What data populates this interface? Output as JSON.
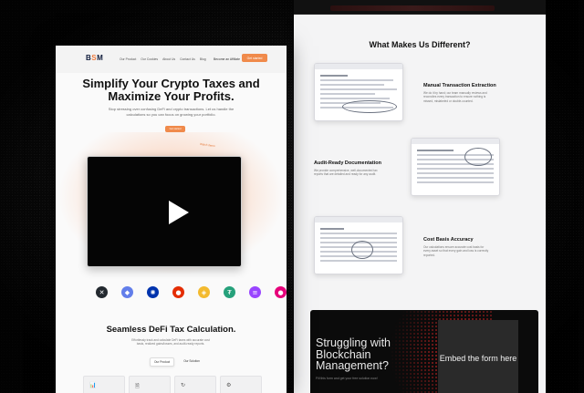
{
  "left_page": {
    "nav": {
      "logo": {
        "b": "B",
        "s": "S",
        "m": "M"
      },
      "links": [
        "Our Product",
        "Our Cookies",
        "About Us",
        "Contact Us",
        "Blog"
      ],
      "affiliate": "Become an Affiliate",
      "cta": "Get started"
    },
    "hero": {
      "title": "Simplify Your Crypto Taxes and Maximize Your Profits.",
      "subtitle": "Stop stressing over confusing DeFi and crypto transactions. Let us handle the calculations so you can focus on growing your portfolio.",
      "button": "Get started",
      "note": "Watch demo"
    },
    "coins": [
      {
        "icon": "xrp-icon",
        "glyph": "✕",
        "color": "#23292f"
      },
      {
        "icon": "ethereum-icon",
        "glyph": "◆",
        "color": "#627eea"
      },
      {
        "icon": "cardano-icon",
        "glyph": "✺",
        "color": "#0033ad"
      },
      {
        "icon": "shiba-icon",
        "glyph": "●",
        "color": "#e42d04"
      },
      {
        "icon": "bnb-icon",
        "glyph": "◈",
        "color": "#f3ba2f"
      },
      {
        "icon": "tether-icon",
        "glyph": "₮",
        "color": "#26a17b"
      },
      {
        "icon": "solana-icon",
        "glyph": "≡",
        "color": "#9945ff"
      },
      {
        "icon": "polkadot-icon",
        "glyph": "●",
        "color": "#e6007a"
      }
    ],
    "section": {
      "title": "Seamless DeFi Tax Calculation.",
      "subtitle": "Effortlessly track and calculate DeFi taxes with accurate cost basis, realized gains/losses, and audit-ready reports.",
      "tabs": [
        "Our Product",
        "Our Solution"
      ],
      "card_icons": [
        "📊",
        "🗎",
        "↻",
        "⚙"
      ]
    }
  },
  "right_page": {
    "heading": "What Makes Us Different?",
    "features": [
      {
        "title": "Manual Transaction Extraction",
        "desc": "We do it by hand; our team manually reviews and reconciles every transaction to ensure nothing is missed, mislabeled or double-counted."
      },
      {
        "title": "Audit-Ready Documentation",
        "desc": "We provide comprehensive, well-documented tax reports that are detailed and ready for any audit."
      },
      {
        "title": "Cost Basis Accuracy",
        "desc": "Our calculations ensure accurate cost basis for every asset so that every gain and loss is correctly reported."
      }
    ],
    "form": {
      "title": "Struggling with Blockchain Management?",
      "subtitle": "Fill this form and get your free solution now!",
      "embed": "Embed the form here"
    }
  }
}
